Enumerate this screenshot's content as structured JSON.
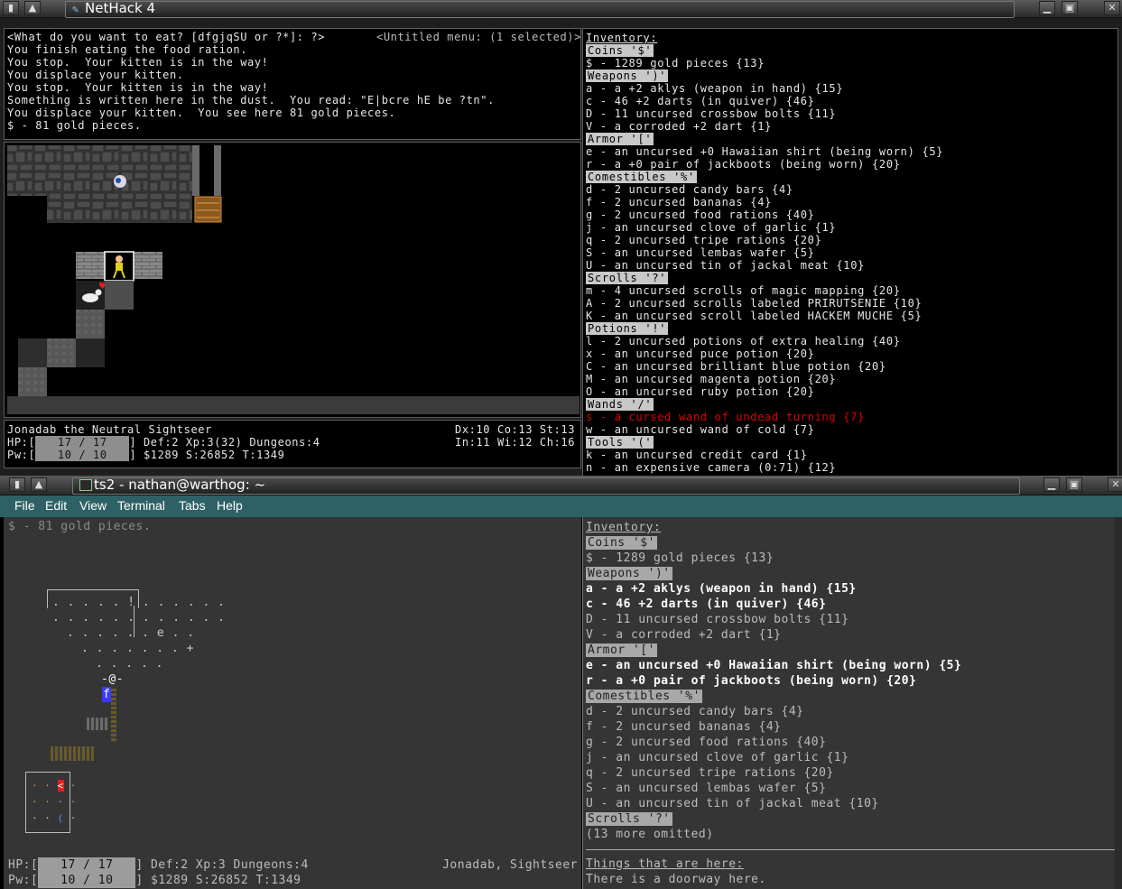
{
  "nethack_window": {
    "title": "NetHack 4",
    "messages": [
      "<What do you want to eat? [dfgjqSU or ?*]: ?>",
      "You finish eating the food ration.",
      "You stop.  Your kitten is in the way!",
      "You displace your kitten.",
      "You stop.  Your kitten is in the way!",
      "Something is written here in the dust.  You read: \"E|bcre hE be ?tn\".",
      "You displace your kitten.  You see here 81 gold pieces.",
      "$ - 81 gold pieces."
    ],
    "menu_status": "<Untitled menu: (1 selected)>",
    "status": {
      "name_line": "Jonadab the Neutral Sightseer",
      "attrs_line1": "Dx:10 Co:13 St:13",
      "attrs_line2": "In:11 Wi:12 Ch:16",
      "hp_label": "HP:[",
      "hp_value": "17 / 17",
      "hp_rest": "] Def:2 Xp:3(32) Dungeons:4",
      "pw_label": "Pw:[",
      "pw_value": "10 / 10",
      "pw_rest": "] $1289 S:26852 T:1349",
      "hp_fraction": 1.0,
      "pw_fraction": 1.0
    },
    "inventory": {
      "title": "Inventory:",
      "lines": [
        {
          "kind": "header",
          "text": "Coins '$'"
        },
        {
          "kind": "item",
          "text": "$ - 1289 gold pieces {13}"
        },
        {
          "kind": "header",
          "text": "Weapons ')'"
        },
        {
          "kind": "item",
          "text": "a - a +2 aklys (weapon in hand) {15}"
        },
        {
          "kind": "item",
          "text": "c - 46 +2 darts (in quiver) {46}"
        },
        {
          "kind": "item",
          "text": "D - 11 uncursed crossbow bolts {11}"
        },
        {
          "kind": "item",
          "text": "V - a corroded +2 dart {1}"
        },
        {
          "kind": "header",
          "text": "Armor '['"
        },
        {
          "kind": "item",
          "text": "e - an uncursed +0 Hawaiian shirt (being worn) {5}"
        },
        {
          "kind": "item",
          "text": "r - a +0 pair of jackboots (being worn) {20}"
        },
        {
          "kind": "header",
          "text": "Comestibles '%'"
        },
        {
          "kind": "item",
          "text": "d - 2 uncursed candy bars {4}"
        },
        {
          "kind": "item",
          "text": "f - 2 uncursed bananas {4}"
        },
        {
          "kind": "item",
          "text": "g - 2 uncursed food rations {40}"
        },
        {
          "kind": "item",
          "text": "j - an uncursed clove of garlic {1}"
        },
        {
          "kind": "item",
          "text": "q - 2 uncursed tripe rations {20}"
        },
        {
          "kind": "item",
          "text": "S - an uncursed lembas wafer {5}"
        },
        {
          "kind": "item",
          "text": "U - an uncursed tin of jackal meat {10}"
        },
        {
          "kind": "header",
          "text": "Scrolls '?'"
        },
        {
          "kind": "item",
          "text": "m - 4 uncursed scrolls of magic mapping {20}"
        },
        {
          "kind": "item",
          "text": "A - 2 uncursed scrolls labeled PRIRUTSENIE {10}"
        },
        {
          "kind": "item",
          "text": "K - an uncursed scroll labeled HACKEM MUCHE {5}"
        },
        {
          "kind": "header",
          "text": "Potions '!'"
        },
        {
          "kind": "item",
          "text": "l - 2 uncursed potions of extra healing {40}"
        },
        {
          "kind": "item",
          "text": "x - an uncursed puce potion {20}"
        },
        {
          "kind": "item",
          "text": "C - an uncursed brilliant blue potion {20}"
        },
        {
          "kind": "item",
          "text": "M - an uncursed magenta potion {20}"
        },
        {
          "kind": "item",
          "text": "O - an uncursed ruby potion {20}"
        },
        {
          "kind": "header",
          "text": "Wands '/'"
        },
        {
          "kind": "cursed",
          "text": "s - a cursed wand of undead turning {7}"
        },
        {
          "kind": "item",
          "text": "w - an uncursed wand of cold {7}"
        },
        {
          "kind": "header",
          "text": "Tools '('"
        },
        {
          "kind": "item",
          "text": "k - an uncursed credit card {1}"
        },
        {
          "kind": "item",
          "text": "n - an expensive camera (0:71) {12}"
        }
      ]
    }
  },
  "terminal_window": {
    "title": "ts2 - nathan@warthog: ~",
    "menu": [
      "File",
      "Edit",
      "View",
      "Terminal",
      "Tabs",
      "Help"
    ],
    "message": "$ - 81 gold pieces.",
    "status": {
      "hp_label": "HP:[",
      "hp_value": "17 / 17",
      "hp_rest": "] Def:2 Xp:3 Dungeons:4",
      "pw_label": "Pw:[",
      "pw_value": "10 / 10",
      "pw_rest": "] $1289 S:26852 T:1349",
      "name": "Jonadab, Sightseer"
    },
    "inventory": {
      "title": "Inventory:",
      "lines": [
        {
          "kind": "header",
          "text": "Coins '$'"
        },
        {
          "kind": "item",
          "text": "$ - 1289 gold pieces {13}"
        },
        {
          "kind": "header",
          "text": "Weapons ')'"
        },
        {
          "kind": "bold",
          "text": "a - a +2 aklys (weapon in hand) {15}"
        },
        {
          "kind": "bold",
          "text": "c - 46 +2 darts (in quiver) {46}"
        },
        {
          "kind": "item",
          "text": "D - 11 uncursed crossbow bolts {11}"
        },
        {
          "kind": "item",
          "text": "V - a corroded +2 dart {1}"
        },
        {
          "kind": "header",
          "text": "Armor '['"
        },
        {
          "kind": "bold",
          "text": "e - an uncursed +0 Hawaiian shirt (being worn) {5}"
        },
        {
          "kind": "bold",
          "text": "r - a +0 pair of jackboots (being worn) {20}"
        },
        {
          "kind": "header",
          "text": "Comestibles '%'"
        },
        {
          "kind": "item",
          "text": "d - 2 uncursed candy bars {4}"
        },
        {
          "kind": "item",
          "text": "f - 2 uncursed bananas {4}"
        },
        {
          "kind": "item",
          "text": "g - 2 uncursed food rations {40}"
        },
        {
          "kind": "item",
          "text": "j - an uncursed clove of garlic {1}"
        },
        {
          "kind": "item",
          "text": "q - 2 uncursed tripe rations {20}"
        },
        {
          "kind": "item",
          "text": "S - an uncursed lembas wafer {5}"
        },
        {
          "kind": "item",
          "text": "U - an uncursed tin of jackal meat {10}"
        },
        {
          "kind": "header",
          "text": "Scrolls '?'"
        },
        {
          "kind": "item",
          "text": "(13 more omitted)"
        }
      ],
      "here_title": "Things that are here:",
      "here_text": "There is a doorway here."
    },
    "ascii_map": [
      {
        "text": ". . . . . ! . . . . . .",
        "color": "#c8c8c8"
      },
      {
        "text": ". . . . . . . . . . . .",
        "color": "#c8c8c8"
      },
      {
        "text": ". . . . . . e . .",
        "color": "#c8c8c8"
      },
      {
        "text": ". . . . . . . +",
        "color": "#c8c8c8"
      },
      {
        "text": ". . . . .",
        "color": "#c8c8c8"
      },
      {
        "text": "-@-",
        "color": "#ffffff"
      },
      {
        "text": "f",
        "color": "#ffffff"
      }
    ]
  }
}
